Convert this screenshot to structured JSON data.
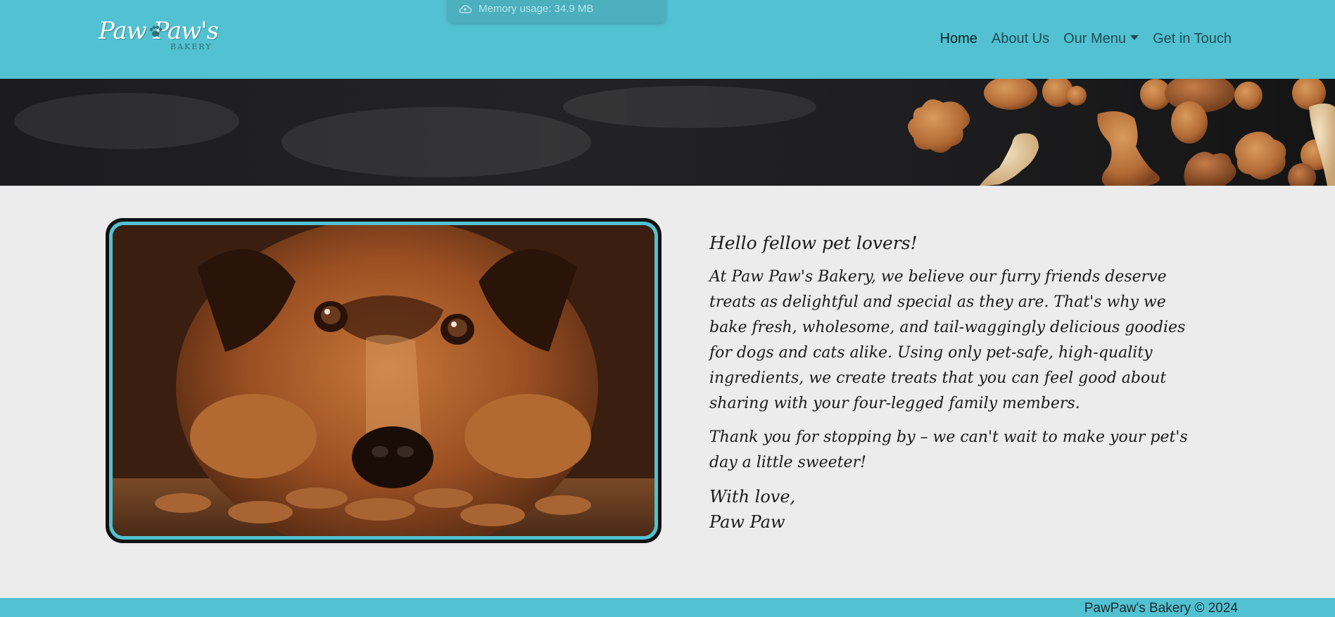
{
  "header": {
    "logo_text": "Paw Paw's",
    "logo_sub": "BAKERY",
    "nav": [
      {
        "label": "Home",
        "active": true
      },
      {
        "label": "About Us"
      },
      {
        "label": "Our Menu",
        "dropdown": true
      },
      {
        "label": "Get in Touch"
      }
    ]
  },
  "overlay": {
    "memory_text": "Memory usage: 34.9 MB",
    "icon": "cloud-icon"
  },
  "banner": {
    "icon": "dog-treats-image"
  },
  "main": {
    "image_icon": "dog-photo",
    "greeting": "Hello fellow pet lovers!",
    "paragraph_1": "At Paw Paw's Bakery, we believe our furry friends deserve treats as delightful and special as they are. That's why we bake fresh, wholesome, and tail-waggingly delicious goodies for dogs and cats alike. Using only pet-safe, high-quality ingredients, we create treats that you can feel good about sharing with your four-legged family members.",
    "paragraph_2": "Thank you for stopping by – we can't wait to make your pet's day a little sweeter!",
    "signoff_1": "With love,",
    "signoff_2": "Paw Paw"
  },
  "footer": {
    "text": "PawPaw's Bakery © 2024"
  },
  "colors": {
    "brand": "#52c1d1",
    "background": "#ececec",
    "banner": "#1c1c1e"
  }
}
